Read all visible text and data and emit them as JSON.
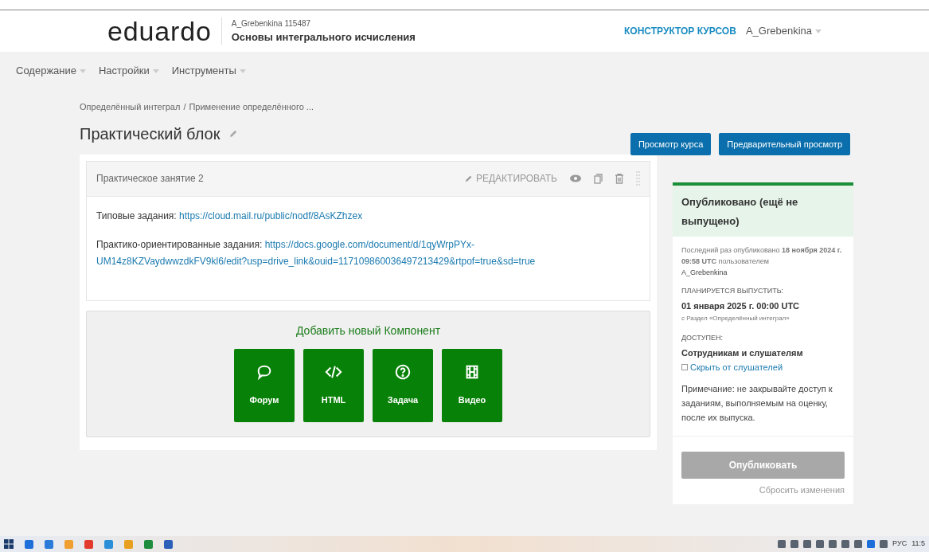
{
  "header": {
    "logo": "eduardo",
    "course_org": "A_Grebenkina 115487",
    "course_title": "Основы интегрального исчисления",
    "studio_link": "КОНСТРУКТОР КУРСОВ",
    "user": "A_Grebenkina"
  },
  "nav": [
    "Содержание",
    "Настройки",
    "Инструменты"
  ],
  "breadcrumb": [
    "Определённый интеграл",
    "/",
    "Применение определённого ..."
  ],
  "page_title": "Практический блок",
  "actions": [
    "Просмотр курса",
    "Предварительный просмотр"
  ],
  "component": {
    "title": "Практическое занятие 2",
    "edit": "РЕДАКТИРОВАТЬ",
    "paragraphs": [
      {
        "label": "Типовые задания: ",
        "link_lines": [
          "https://cloud.mail.ru/public/nodf/8AsKZhzex"
        ]
      },
      {
        "label": "Практико-ориентированные задания: ",
        "link_lines": [
          "https://docs.google.com/document/d/1qyWrpPYx-",
          "UM14z8KZVaydwwzdkFV9kl6/edit?usp=drive_link&ouid=117109860036497213429&rtpof=true&sd=true"
        ]
      }
    ]
  },
  "add_component": {
    "title": "Добавить новый Компонент",
    "buttons": [
      {
        "kind": "forum",
        "label": "Форум"
      },
      {
        "kind": "html",
        "label": "HTML"
      },
      {
        "kind": "problem",
        "label": "Задача"
      },
      {
        "kind": "video",
        "label": "Видео"
      }
    ]
  },
  "sidebar": {
    "status": "Опубликовано (ещё не выпущено)",
    "last_published": "Последний раз опубликовано **18 ноября 2024 г. 09:58 UTC** пользователем",
    "publisher": "A_Grebenkina",
    "release_label": "ПЛАНИРУЕТСЯ ВЫПУСТИТЬ:",
    "release_date": "01 января 2025 г. 00:00 UTC",
    "release_source": "с Раздел «Определённый интеграл»",
    "visibility_label": "ДОСТУПЕН:",
    "visibility": "Сотрудникам и слушателям",
    "hide_checkbox": {
      "label": "Скрыть от слушателей",
      "checked": false
    },
    "note": "Примечание: не закрывайте доступ к заданиям, выполняемым на оценку, после их выпуска.",
    "publish_button": {
      "label": "Опубликовать",
      "disabled": true
    },
    "discard": "Сбросить изменения"
  },
  "taskbar": {
    "language": "РУС",
    "time": "11:5"
  }
}
